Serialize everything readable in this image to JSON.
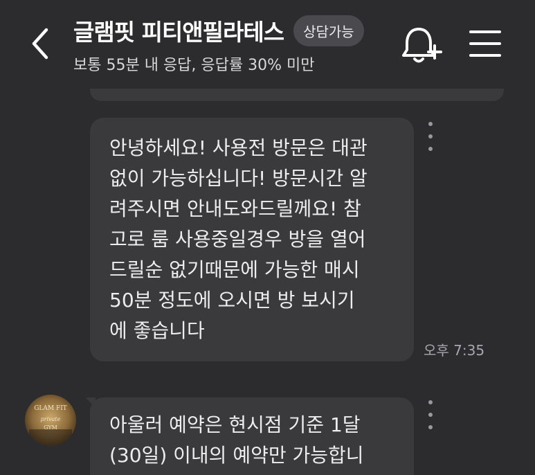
{
  "header": {
    "title": "글램핏 피티앤필라테스",
    "badge": "상담가능",
    "subtitle": "보통 55분 내 응답, 응답률 30% 미만",
    "icons": {
      "back": "chevron-left-icon",
      "bell": "bell-plus-icon",
      "menu": "hamburger-menu-icon"
    }
  },
  "messages": [
    {
      "lines": [
        "안녕하세요! 사용전 방문은 대관",
        "없이 가능하십니다! 방문시간 알",
        "려주시면 안내도와드릴께요! 참",
        "고로 룸 사용중일경우 방을 열어",
        "드릴순 없기때문에 가능한 매시",
        "50분 정도에 오시면 방 보시기",
        "에 좋습니다"
      ],
      "time": "오후 7:35"
    },
    {
      "lines": [
        "아울러 예약은 현시점 기준 1달",
        "(30일) 이내의 예약만 가능합니"
      ]
    }
  ],
  "avatar": {
    "logo_text": [
      "GLAM FIT",
      "private",
      "GYM"
    ]
  },
  "colors": {
    "background": "#2c2c2e",
    "bubble": "#3a3a3c",
    "badge": "#4a4a4e",
    "text": "#ededed"
  }
}
